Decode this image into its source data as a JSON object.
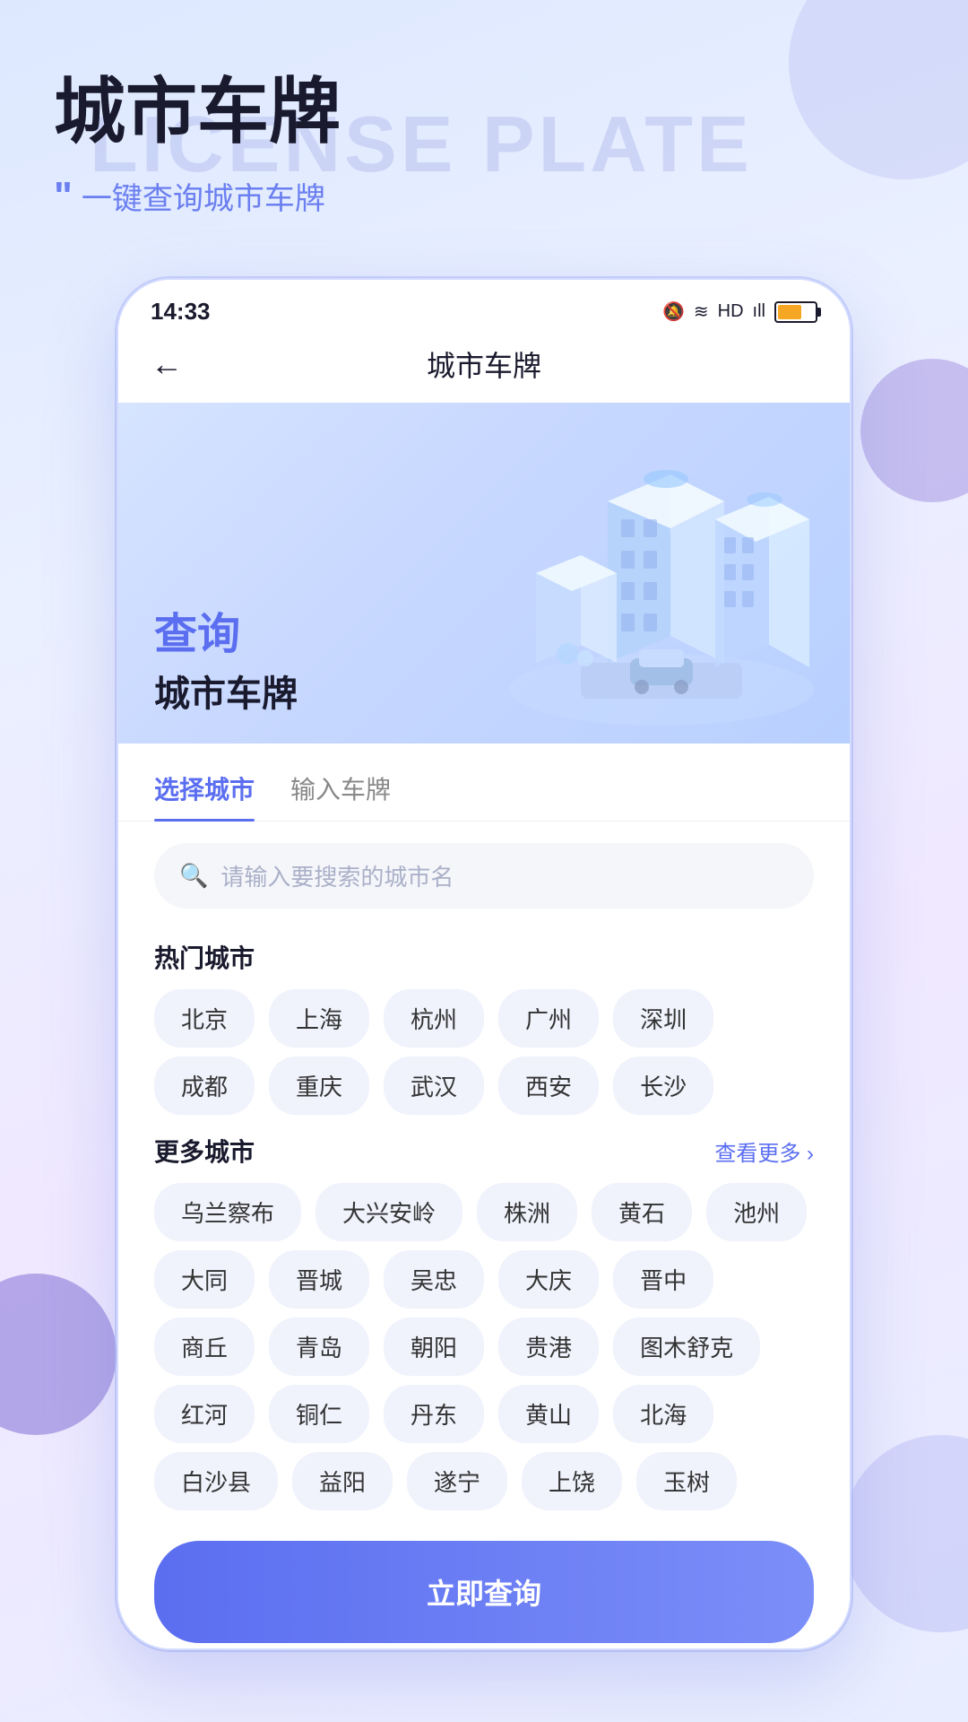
{
  "background": {
    "bgTitleText": "LICENSE PLATE"
  },
  "header": {
    "mainTitle": "城市车牌",
    "quoteIcon": "““",
    "subtitle": "一键查询城市车牌"
  },
  "phone": {
    "statusBar": {
      "time": "14:33",
      "icons": "🔕 ≋ HD ıll"
    },
    "navBar": {
      "backIcon": "←",
      "title": "城市车牌"
    },
    "hero": {
      "queryLabel": "查询",
      "subtitle": "城市车牌"
    },
    "tabs": [
      {
        "label": "选择城市",
        "active": true
      },
      {
        "label": "输入车牌",
        "active": false
      }
    ],
    "search": {
      "placeholder": "请输入要搜索的城市名"
    },
    "hotCities": {
      "sectionTitle": "热门城市",
      "cities": [
        "北京",
        "上海",
        "杭州",
        "广州",
        "深圳",
        "成都",
        "重庆",
        "武汉",
        "西安",
        "长沙"
      ]
    },
    "moreCities": {
      "sectionTitle": "更多城市",
      "moreLabel": "查看更多",
      "moreArrow": "›",
      "cities": [
        "乌兰察布",
        "大兴安岭",
        "株洲",
        "黄石",
        "池州",
        "大同",
        "晋城",
        "吴忠",
        "大庆",
        "晋中",
        "商丘",
        "青岛",
        "朝阳",
        "贵港",
        "图木舒克",
        "红河",
        "铜仁",
        "丹东",
        "黄山",
        "北海",
        "白沙县",
        "益阳",
        "遂宁",
        "上饶",
        "玉树"
      ]
    },
    "queryButton": {
      "label": "立即查询"
    }
  }
}
